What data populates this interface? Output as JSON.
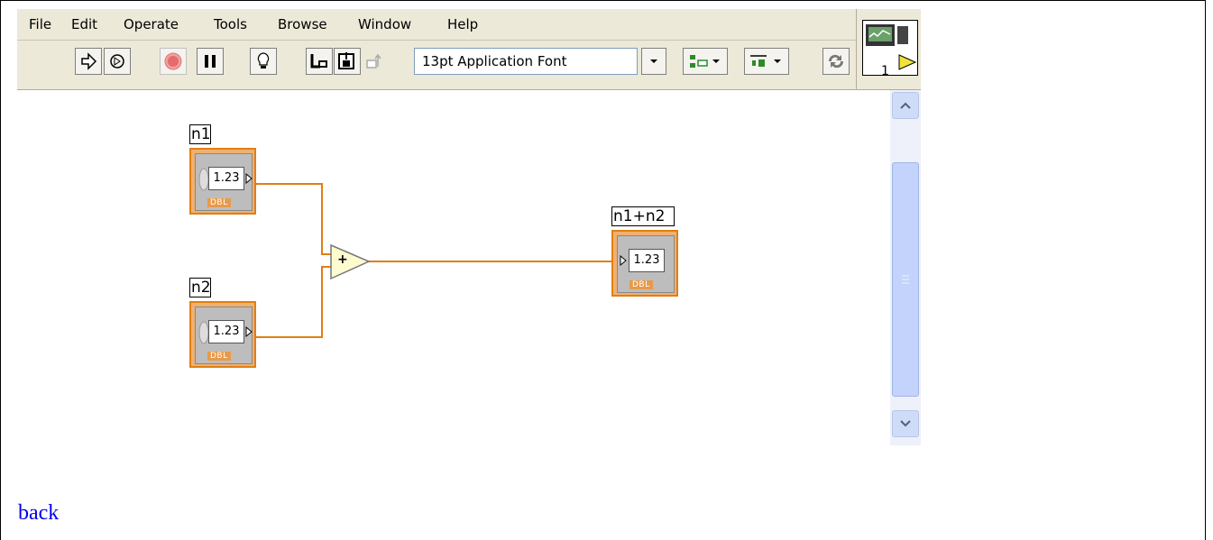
{
  "menu": {
    "items": [
      "File",
      "Edit",
      "Operate",
      "Tools",
      "Browse",
      "Window",
      "Help"
    ]
  },
  "toolbar": {
    "font_selector": "13pt Application Font"
  },
  "vi_icon": {
    "number": "1"
  },
  "diagram": {
    "control_n1": {
      "label": "n1",
      "value": "1.23",
      "type": "DBL"
    },
    "control_n2": {
      "label": "n2",
      "value": "1.23",
      "type": "DBL"
    },
    "indicator_sum": {
      "label": "n1+n2",
      "value": "1.23",
      "type": "DBL"
    },
    "add_function": {
      "symbol": "+"
    },
    "wire_color": "#e07f14"
  },
  "footer": {
    "back_link": "back"
  }
}
